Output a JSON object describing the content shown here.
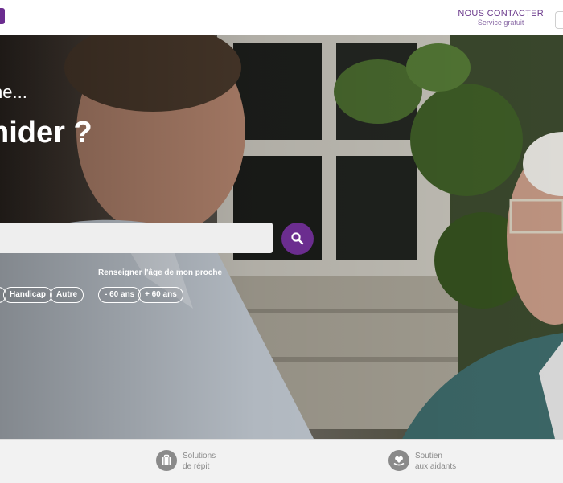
{
  "header": {
    "contact_title": "NOUS CONTACTER",
    "contact_subtitle": "Service gratuit"
  },
  "hero": {
    "line1": "che...",
    "line2": "nider ?",
    "search": {
      "value": "",
      "placeholder": ""
    },
    "age_label": "Renseigner l'âge de mon proche",
    "situation_pills": [
      "Handicap",
      "Autre"
    ],
    "age_pills": [
      "- 60 ans",
      "+ 60 ans"
    ]
  },
  "bottom_bar": {
    "items": [
      {
        "line1": "Solutions",
        "line2": "de répit",
        "icon": "suitcase-icon"
      },
      {
        "line1": "Soutien",
        "line2": "aux aidants",
        "icon": "heart-hand-icon"
      }
    ]
  },
  "colors": {
    "brand_purple": "#6b2d8f",
    "contact_text": "#6b3a8c",
    "bottom_bar_bg": "#f2f2f2",
    "bottom_text": "#8a8a8a"
  }
}
